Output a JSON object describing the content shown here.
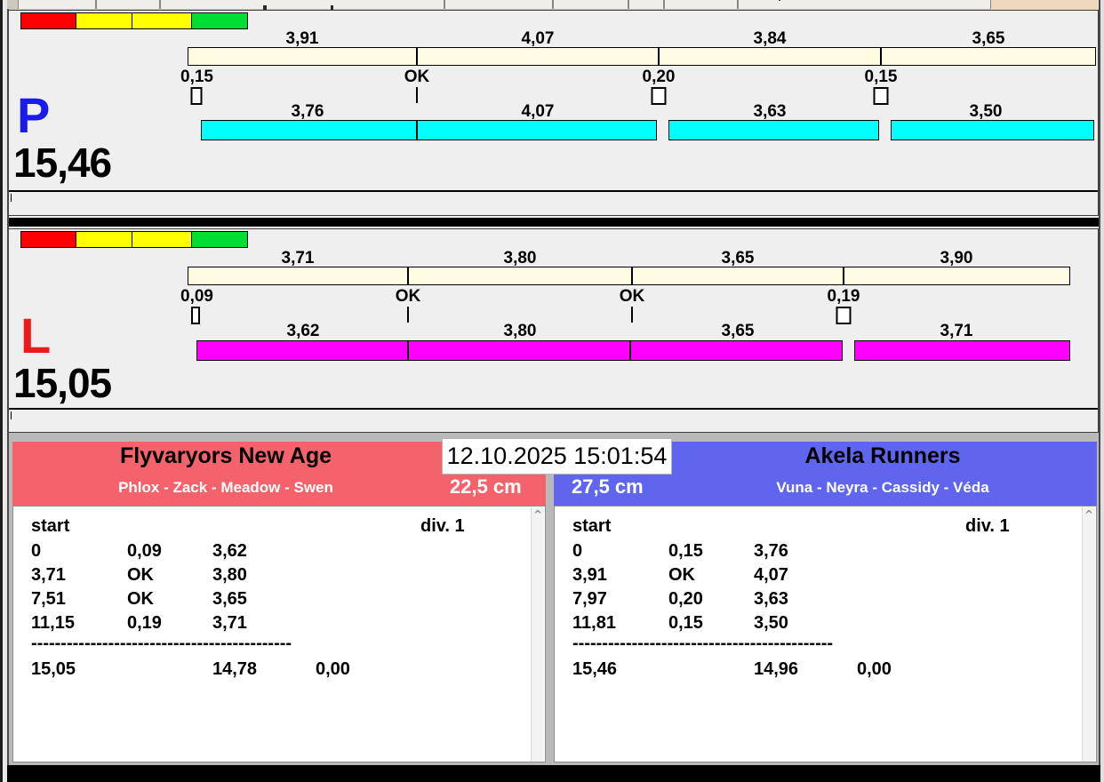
{
  "datetime": "12.10.2025 15:01:54",
  "icons": {
    "scroll_up": "^",
    "toolbar_chevron": "˅"
  },
  "colors": {
    "lane_bg": "#efefef",
    "plan_bar": "#fffce1",
    "lane_p_bar": "#00ffff",
    "lane_l_bar": "#ff00ff",
    "lane_p_letter": "#1a1aee",
    "lane_l_letter": "#ee1a1a",
    "team_left_header": "#f4636b",
    "team_right_header": "#6065ee",
    "traffic_lights": [
      "#ff0000",
      "#ffff00",
      "#ffff00",
      "#00dd33"
    ]
  },
  "lanes": [
    {
      "letter": "P",
      "total": "15,46",
      "plan_values": [
        "3,91",
        "4,07",
        "3,84",
        "3,65"
      ],
      "splits": [
        "0,15",
        "OK",
        "0,20",
        "0,15"
      ],
      "run_values": [
        "3,76",
        "4,07",
        "3,63",
        "3,50"
      ]
    },
    {
      "letter": "L",
      "total": "15,05",
      "plan_values": [
        "3,71",
        "3,80",
        "3,65",
        "3,90"
      ],
      "splits": [
        "0,09",
        "OK",
        "OK",
        "0,19"
      ],
      "run_values": [
        "3,62",
        "3,80",
        "3,65",
        "3,71"
      ]
    }
  ],
  "teams": [
    {
      "name": "Flyvaryors New Age",
      "members": "Phlox - Zack - Meadow - Swen",
      "height": "22,5 cm",
      "start_label": "start",
      "div_label": "div. 1",
      "rows": [
        {
          "t": "0",
          "d": "0,09",
          "s": "3,62"
        },
        {
          "t": "3,71",
          "d": "OK",
          "s": "3,80"
        },
        {
          "t": "7,51",
          "d": "OK",
          "s": "3,65"
        },
        {
          "t": "11,15",
          "d": "0,19",
          "s": "3,71"
        }
      ],
      "separator": "--------------------------------------------",
      "total_time": "15,05",
      "total_sum": "14,78",
      "total_diff": "0,00"
    },
    {
      "name": "Akela Runners",
      "members": "Vuna - Neyra - Cassidy - Véda",
      "height": "27,5 cm",
      "start_label": "start",
      "div_label": "div. 1",
      "rows": [
        {
          "t": "0",
          "d": "0,15",
          "s": "3,76"
        },
        {
          "t": "3,91",
          "d": "OK",
          "s": "4,07"
        },
        {
          "t": "7,97",
          "d": "0,20",
          "s": "3,63"
        },
        {
          "t": "11,81",
          "d": "0,15",
          "s": "3,50"
        }
      ],
      "separator": "--------------------------------------------",
      "total_time": "15,46",
      "total_sum": "14,96",
      "total_diff": "0,00"
    }
  ]
}
